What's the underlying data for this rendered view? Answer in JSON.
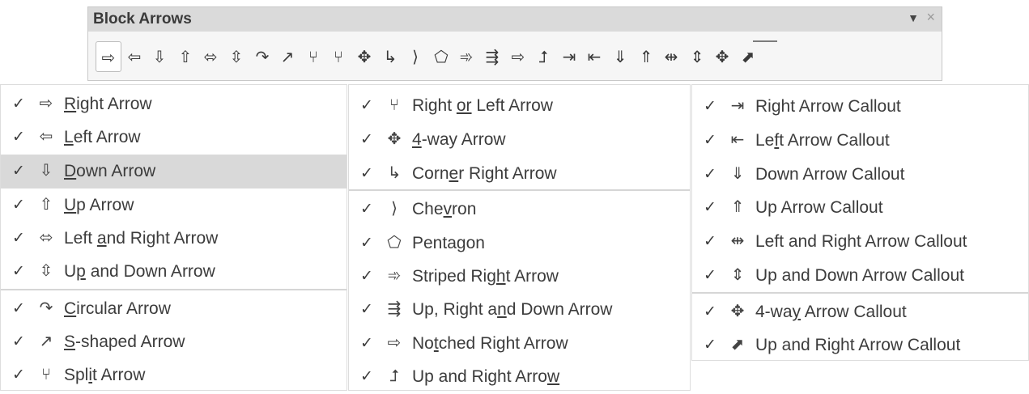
{
  "toolbar": {
    "title": "Block Arrows",
    "menu_icon": "menu-triangle",
    "close_icon": "close-x",
    "buttons": [
      {
        "name": "right-arrow",
        "glyph": "⇨",
        "selected": true
      },
      {
        "name": "left-arrow",
        "glyph": "⇦"
      },
      {
        "name": "down-arrow",
        "glyph": "⇩"
      },
      {
        "name": "up-arrow",
        "glyph": "⇧"
      },
      {
        "name": "left-right-arrow",
        "glyph": "⬄"
      },
      {
        "name": "up-down-arrow",
        "glyph": "⇳"
      },
      {
        "name": "circular-arrow",
        "glyph": "↷"
      },
      {
        "name": "s-shaped-arrow",
        "glyph": "↗"
      },
      {
        "name": "split-arrow",
        "glyph": "⑂"
      },
      {
        "name": "right-or-left-arrow",
        "glyph": "⑂"
      },
      {
        "name": "4-way-arrow",
        "glyph": "✥"
      },
      {
        "name": "corner-right-arrow",
        "glyph": "↳"
      },
      {
        "name": "chevron",
        "glyph": "⟩"
      },
      {
        "name": "pentagon",
        "glyph": "⬠"
      },
      {
        "name": "striped-right-arrow",
        "glyph": "➾"
      },
      {
        "name": "up-right-down-arrow",
        "glyph": "⇶"
      },
      {
        "name": "notched-right-arrow",
        "glyph": "⇨"
      },
      {
        "name": "up-and-right-arrow",
        "glyph": "⮥"
      },
      {
        "name": "right-arrow-callout",
        "glyph": "⇥"
      },
      {
        "name": "left-arrow-callout",
        "glyph": "⇤"
      },
      {
        "name": "down-arrow-callout",
        "glyph": "⇓"
      },
      {
        "name": "up-arrow-callout",
        "glyph": "⇑"
      },
      {
        "name": "left-right-arrow-callout",
        "glyph": "⇹"
      },
      {
        "name": "up-down-arrow-callout",
        "glyph": "⇕"
      },
      {
        "name": "4-way-arrow-callout",
        "glyph": "✥"
      },
      {
        "name": "up-right-arrow-callout",
        "glyph": "⬈"
      }
    ]
  },
  "menus": {
    "check_glyph": "✓",
    "col1": [
      {
        "pre": "",
        "u": "R",
        "post": "ight Arrow",
        "icon": "⇨",
        "icon_name": "right-arrow-icon"
      },
      {
        "pre": "",
        "u": "L",
        "post": "eft Arrow",
        "icon": "⇦",
        "icon_name": "left-arrow-icon"
      },
      {
        "pre": "",
        "u": "D",
        "post": "own Arrow",
        "icon": "⇩",
        "icon_name": "down-arrow-icon",
        "highlighted": true
      },
      {
        "pre": "",
        "u": "U",
        "post": "p Arrow",
        "icon": "⇧",
        "icon_name": "up-arrow-icon"
      },
      {
        "pre": "Left ",
        "u": "a",
        "post": "nd Right Arrow",
        "icon": "⬄",
        "icon_name": "left-right-arrow-icon"
      },
      {
        "pre": "U",
        "u": "p",
        "post": " and Down Arrow",
        "icon": "⇳",
        "icon_name": "up-down-arrow-icon"
      },
      {
        "pre": "",
        "u": "C",
        "post": "ircular Arrow",
        "icon": "↷",
        "icon_name": "circular-arrow-icon"
      },
      {
        "pre": "",
        "u": "S",
        "post": "-shaped Arrow",
        "icon": "↗",
        "icon_name": "s-shaped-arrow-icon"
      },
      {
        "pre": "Spl",
        "u": "i",
        "post": "t Arrow",
        "icon": "⑂",
        "icon_name": "split-arrow-icon"
      }
    ],
    "col2": [
      {
        "pre": "Right ",
        "u": "or",
        "post": " Left Arrow",
        "icon": "⑂",
        "icon_name": "right-or-left-arrow-icon"
      },
      {
        "pre": "",
        "u": "4",
        "post": "-way Arrow",
        "icon": "✥",
        "icon_name": "4-way-arrow-icon"
      },
      {
        "pre": "Corn",
        "u": "e",
        "post": "r Right Arrow",
        "icon": "↳",
        "icon_name": "corner-right-arrow-icon"
      },
      {
        "pre": "Che",
        "u": "v",
        "post": "ron",
        "icon": "⟩",
        "icon_name": "chevron-icon"
      },
      {
        "pre": "Penta",
        "u": "g",
        "post": "on",
        "icon": "⬠",
        "icon_name": "pentagon-icon"
      },
      {
        "pre": "Striped Rig",
        "u": "h",
        "post": "t Arrow",
        "icon": "➾",
        "icon_name": "striped-right-arrow-icon"
      },
      {
        "pre": "Up, Right a",
        "u": "n",
        "post": "d Down Arrow",
        "icon": "⇶",
        "icon_name": "up-right-down-arrow-icon"
      },
      {
        "pre": "No",
        "u": "t",
        "post": "ched Right Arrow",
        "icon": "⇨",
        "icon_name": "notched-right-arrow-icon"
      },
      {
        "pre": "Up and Right Arro",
        "u": "w",
        "post": "",
        "icon": "⮥",
        "icon_name": "up-and-right-arrow-icon"
      }
    ],
    "col3": [
      {
        "pre": "Right Arrow Callout",
        "u": "",
        "post": "",
        "icon": "⇥",
        "icon_name": "right-arrow-callout-icon"
      },
      {
        "pre": "Le",
        "u": "f",
        "post": "t Arrow Callout",
        "icon": "⇤",
        "icon_name": "left-arrow-callout-icon"
      },
      {
        "pre": "Down Arrow Callout",
        "u": "",
        "post": "",
        "icon": "⇓",
        "icon_name": "down-arrow-callout-icon"
      },
      {
        "pre": "Up Arrow Callout",
        "u": "",
        "post": "",
        "icon": "⇑",
        "icon_name": "up-arrow-callout-icon"
      },
      {
        "pre": "Left and Right Arrow Callout",
        "u": "",
        "post": "",
        "icon": "⇹",
        "icon_name": "left-right-arrow-callout-icon"
      },
      {
        "pre": "Up and Down Arrow Callout",
        "u": "",
        "post": "",
        "icon": "⇕",
        "icon_name": "up-down-arrow-callout-icon"
      },
      {
        "pre": "4-wa",
        "u": "y",
        "post": " Arrow Callout",
        "icon": "✥",
        "icon_name": "4-way-arrow-callout-icon"
      },
      {
        "pre": "Up and Right Arrow Callout",
        "u": "",
        "post": "",
        "icon": "⬈",
        "icon_name": "up-right-arrow-callout-icon"
      }
    ]
  }
}
